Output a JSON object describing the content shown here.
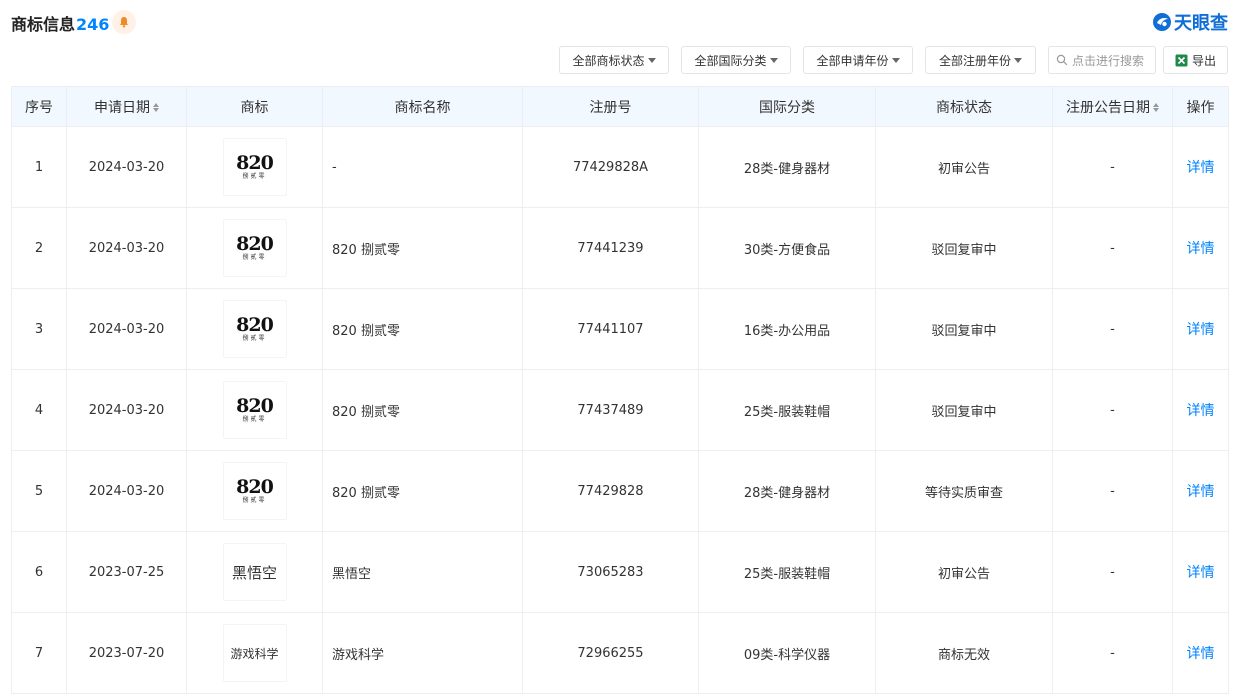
{
  "header": {
    "title": "商标信息",
    "count": "246",
    "brand": "天眼查"
  },
  "toolbar": {
    "filters": [
      "全部商标状态",
      "全部国际分类",
      "全部申请年份",
      "全部注册年份"
    ],
    "search_placeholder": "点击进行搜索",
    "export_label": "导出"
  },
  "table": {
    "columns": [
      "序号",
      "申请日期",
      "商标",
      "商标名称",
      "注册号",
      "国际分类",
      "商标状态",
      "注册公告日期",
      "操作"
    ],
    "rows": [
      {
        "index": "1",
        "date": "2024-03-20",
        "mark": {
          "type": "logo",
          "num": "820",
          "sub": "捌贰零"
        },
        "name": "-",
        "reg_no": "77429828A",
        "class": "28类-健身器材",
        "status": "初审公告",
        "announce": "-",
        "action": "详情"
      },
      {
        "index": "2",
        "date": "2024-03-20",
        "mark": {
          "type": "logo",
          "num": "820",
          "sub": "捌贰零"
        },
        "name": "820 捌贰零",
        "reg_no": "77441239",
        "class": "30类-方便食品",
        "status": "驳回复审中",
        "announce": "-",
        "action": "详情"
      },
      {
        "index": "3",
        "date": "2024-03-20",
        "mark": {
          "type": "logo",
          "num": "820",
          "sub": "捌贰零"
        },
        "name": "820 捌贰零",
        "reg_no": "77441107",
        "class": "16类-办公用品",
        "status": "驳回复审中",
        "announce": "-",
        "action": "详情"
      },
      {
        "index": "4",
        "date": "2024-03-20",
        "mark": {
          "type": "logo",
          "num": "820",
          "sub": "捌贰零"
        },
        "name": "820 捌贰零",
        "reg_no": "77437489",
        "class": "25类-服装鞋帽",
        "status": "驳回复审中",
        "announce": "-",
        "action": "详情"
      },
      {
        "index": "5",
        "date": "2024-03-20",
        "mark": {
          "type": "logo",
          "num": "820",
          "sub": "捌贰零"
        },
        "name": "820 捌贰零",
        "reg_no": "77429828",
        "class": "28类-健身器材",
        "status": "等待实质审查",
        "announce": "-",
        "action": "详情"
      },
      {
        "index": "6",
        "date": "2023-07-25",
        "mark": {
          "type": "text",
          "text": "黑悟空"
        },
        "name": "黑悟空",
        "reg_no": "73065283",
        "class": "25类-服装鞋帽",
        "status": "初审公告",
        "announce": "-",
        "action": "详情"
      },
      {
        "index": "7",
        "date": "2023-07-20",
        "mark": {
          "type": "text-small",
          "text": "游戏科学"
        },
        "name": "游戏科学",
        "reg_no": "72966255",
        "class": "09类-科学仪器",
        "status": "商标无效",
        "announce": "-",
        "action": "详情"
      }
    ]
  },
  "icons": {
    "bell": "bell-icon",
    "brand_logo": "tianyancha-logo-icon",
    "search": "search-icon",
    "export": "excel-icon",
    "sort": "sort-arrows-icon"
  },
  "colors": {
    "accent": "#0084ff",
    "header_bg": "#f2f8ff",
    "bell": "#f08a24",
    "excel": "#1f8a47"
  }
}
